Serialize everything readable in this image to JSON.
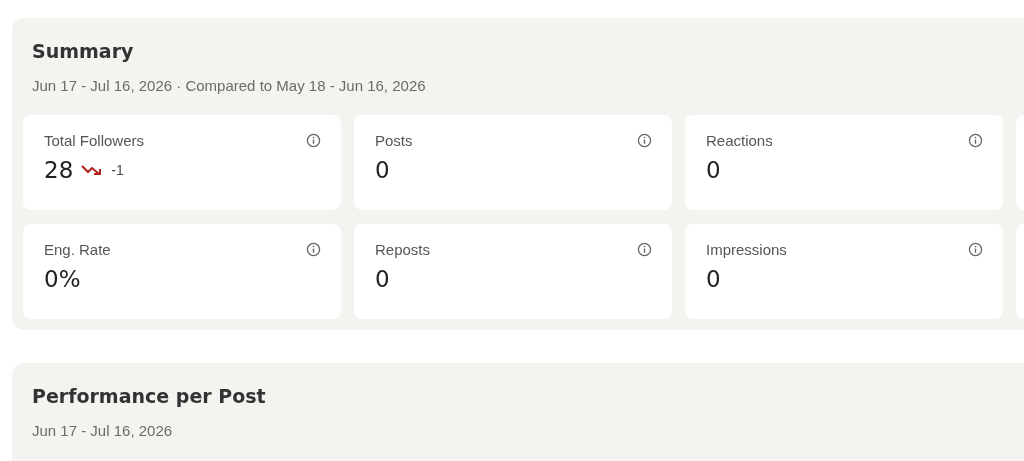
{
  "summary": {
    "title": "Summary",
    "period": "Jun 17 - Jul 16, 2026 · Compared to May 18 - Jun 16, 2026",
    "metrics": [
      {
        "label": "Total Followers",
        "value": "28",
        "falling": true,
        "delta": "-1"
      },
      {
        "label": "Posts",
        "value": "0"
      },
      {
        "label": "Reactions",
        "value": "0"
      },
      {
        "label": "Eng. Rate",
        "value": "0%"
      },
      {
        "label": "Reposts",
        "value": "0"
      },
      {
        "label": "Impressions",
        "value": "0"
      }
    ]
  },
  "performance": {
    "title": "Performance per Post",
    "period": "Jun 17 - Jul 16, 2026"
  }
}
